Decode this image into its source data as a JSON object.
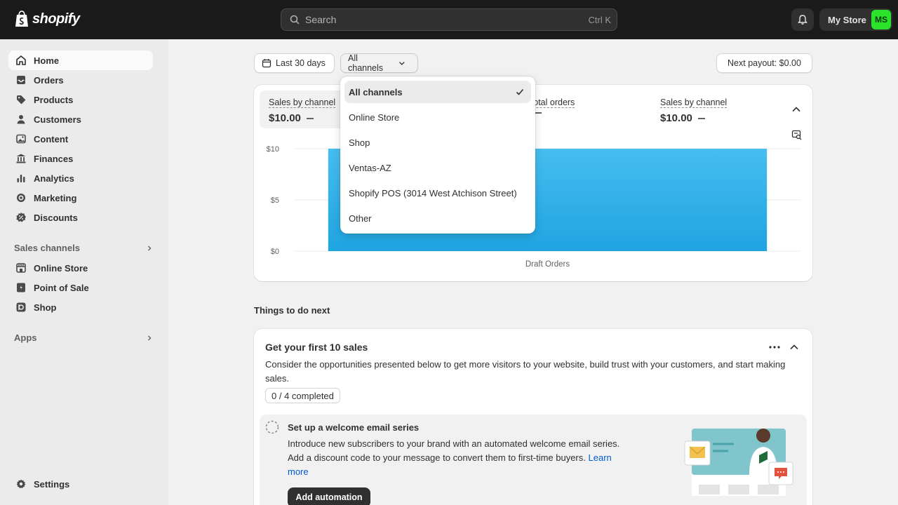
{
  "topbar": {
    "brand": "shopify",
    "search_placeholder": "Search",
    "search_shortcut": "Ctrl K",
    "store_name": "My Store",
    "avatar_initials": "MS",
    "avatar_color": "#2be32b"
  },
  "sidebar": {
    "items": [
      {
        "label": "Home",
        "icon": "home-icon"
      },
      {
        "label": "Orders",
        "icon": "inbox-icon"
      },
      {
        "label": "Products",
        "icon": "tag-icon"
      },
      {
        "label": "Customers",
        "icon": "person-icon"
      },
      {
        "label": "Content",
        "icon": "image-icon"
      },
      {
        "label": "Finances",
        "icon": "bank-icon"
      },
      {
        "label": "Analytics",
        "icon": "bar-chart-icon"
      },
      {
        "label": "Marketing",
        "icon": "target-icon"
      },
      {
        "label": "Discounts",
        "icon": "discount-icon"
      }
    ],
    "sales_channels_label": "Sales channels",
    "channels": [
      {
        "label": "Online Store",
        "icon": "store-icon"
      },
      {
        "label": "Point of Sale",
        "icon": "pos-icon"
      },
      {
        "label": "Shop",
        "icon": "shop-icon"
      }
    ],
    "apps_label": "Apps",
    "settings_label": "Settings"
  },
  "filters": {
    "date_range": "Last 30 days",
    "channel": "All channels",
    "payout": "Next payout: $0.00"
  },
  "metrics": [
    {
      "label": "Sales by channel",
      "value": "$10.00"
    },
    {
      "label": "Total orders",
      "value": ""
    },
    {
      "label": "Sales by channel",
      "value": "$10.00"
    }
  ],
  "chart_data": {
    "type": "bar",
    "categories": [
      "Draft Orders"
    ],
    "values": [
      10
    ],
    "y_ticks": [
      "$10",
      "$5",
      "$0"
    ],
    "ylim": [
      0,
      10
    ],
    "bar_color": "#1fa4e0",
    "grid": true
  },
  "dropdown": {
    "options": [
      "All channels",
      "Online Store",
      "Shop",
      "Ventas-AZ",
      "Shopify POS (3014 West Atchison Street)",
      "Other"
    ],
    "selected": "All channels"
  },
  "todo": {
    "section_title": "Things to do next",
    "card_title": "Get your first 10 sales",
    "card_description": "Consider the opportunities presented below to get more visitors to your website, build trust with your customers, and start making sales.",
    "progress": "0 / 4 completed",
    "task_title": "Set up a welcome email series",
    "task_description": "Introduce new subscribers to your brand with an automated welcome email series. Add a discount code to your message to convert them to first-time buyers.",
    "task_link": "Learn more",
    "task_button": "Add automation"
  }
}
